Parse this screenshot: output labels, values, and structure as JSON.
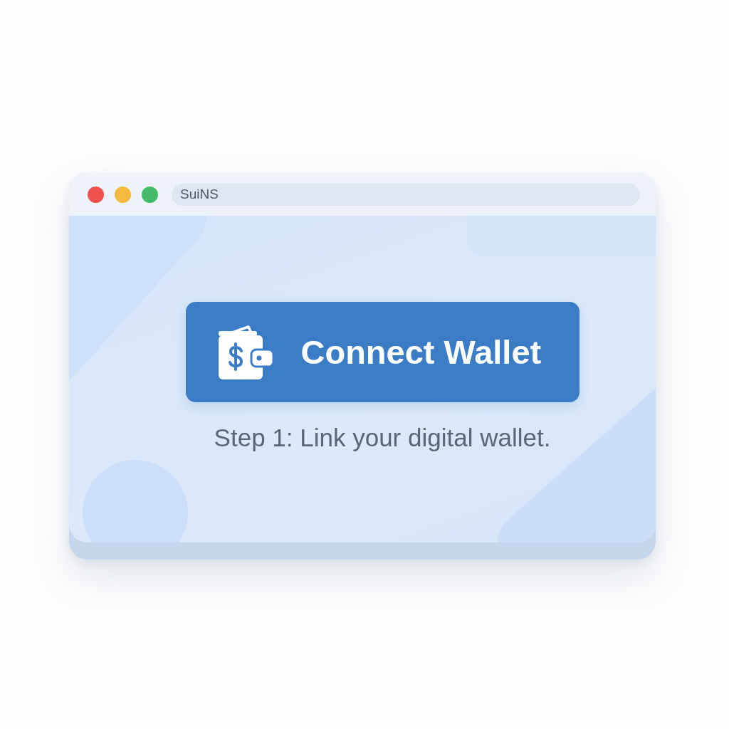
{
  "window": {
    "title_bar": {
      "controls": [
        {
          "color": "#f0524f"
        },
        {
          "color": "#f5b942"
        },
        {
          "color": "#44bb66"
        }
      ],
      "address": "SuiNS"
    }
  },
  "content": {
    "button": {
      "label": "Connect Wallet"
    },
    "caption": "Step 1: Link your digital wallet."
  }
}
